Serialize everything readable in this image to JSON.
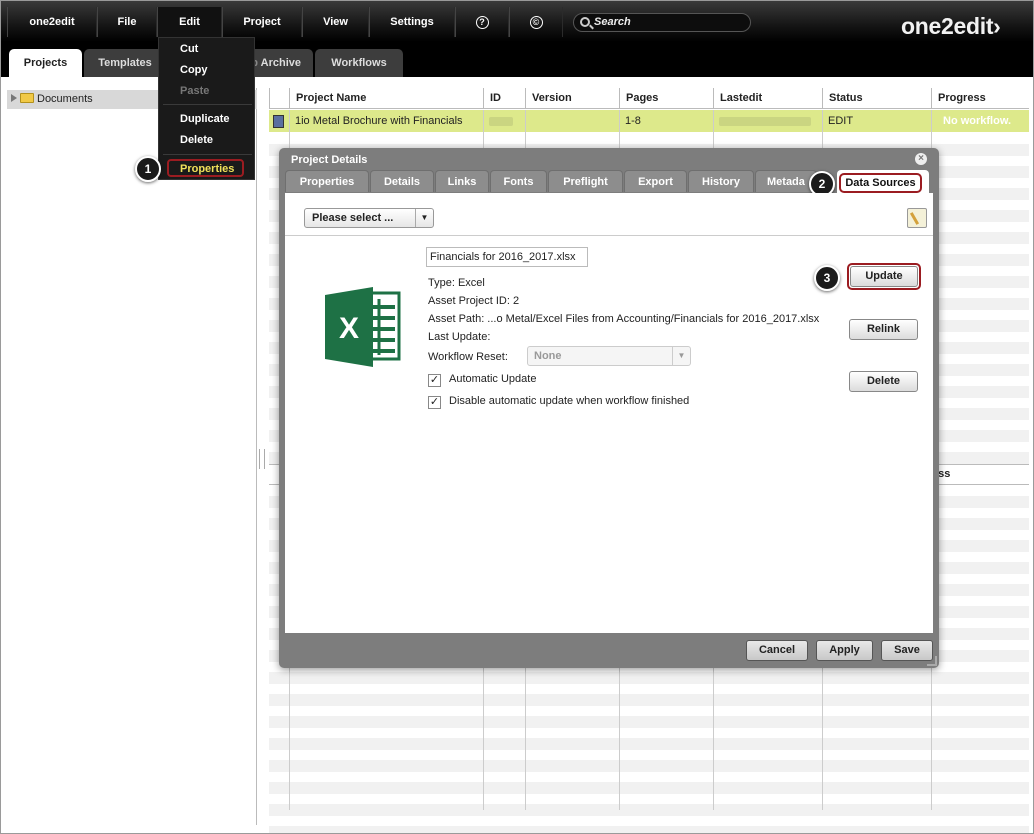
{
  "menubar": {
    "items": [
      "one2edit",
      "File",
      "Edit",
      "Project",
      "View",
      "Settings"
    ],
    "help_glyph": "?",
    "copyright_glyph": "©",
    "search_placeholder": "Search",
    "logo": "one2edit",
    "logo_mark": "›"
  },
  "tabs": [
    "Projects",
    "Templates",
    "Job Archive",
    "Workflows"
  ],
  "tab_partial_label": "Job",
  "tab_archive_label": "Archive",
  "edit_menu": {
    "items": [
      {
        "label": "Cut",
        "enabled": true
      },
      {
        "label": "Copy",
        "enabled": true
      },
      {
        "label": "Paste",
        "enabled": false
      },
      {
        "label": "Duplicate",
        "enabled": true
      },
      {
        "label": "Delete",
        "enabled": true
      },
      {
        "label": "Properties",
        "enabled": true,
        "highlighted": true
      }
    ]
  },
  "tree": {
    "root": "Documents"
  },
  "grid": {
    "columns": [
      "Project Name",
      "ID",
      "Version",
      "Pages",
      "Lastedit",
      "Status",
      "Progress"
    ],
    "rows": [
      {
        "name": "1io Metal Brochure with Financials",
        "id": "",
        "version": "",
        "pages": "1-8",
        "lastedit": "",
        "status": "EDIT",
        "progress": "No workflow."
      }
    ],
    "second_header_partial": "gress"
  },
  "callouts": [
    "1",
    "2",
    "3"
  ],
  "dialog": {
    "title": "Project Details",
    "close_glyph": "×",
    "tabs": [
      "Properties",
      "Details",
      "Links",
      "Fonts",
      "Preflight",
      "Export",
      "History",
      "Metada",
      "Data Sources"
    ],
    "active_tab": "Data Sources",
    "select_label": "Please select ...",
    "file_name": "Financials for 2016_2017.xlsx",
    "type_line": "Type: Excel",
    "asset_id_line": "Asset Project ID: 2",
    "asset_path_line": "Asset Path: ...o Metal/Excel Files from Accounting/Financials for 2016_2017.xlsx",
    "last_update_line": "Last Update:",
    "workflow_reset_label": "Workflow Reset:",
    "workflow_reset_value": "None",
    "auto_update_label": "Automatic Update",
    "auto_update_checked": true,
    "disable_auto_label": "Disable automatic update when workflow finished",
    "disable_auto_checked": true,
    "check_glyph": "✓",
    "dropdown_glyph": "▼",
    "excel_glyph": "X",
    "buttons": {
      "update": "Update",
      "relink": "Relink",
      "delete": "Delete"
    },
    "footer": {
      "cancel": "Cancel",
      "apply": "Apply",
      "save": "Save"
    }
  },
  "colors": {
    "row_highlight": "#dde98b",
    "callout_ring": "#9b1c21",
    "excel_green": "#1e7145",
    "menu_highlight_text": "#f0e05a"
  }
}
